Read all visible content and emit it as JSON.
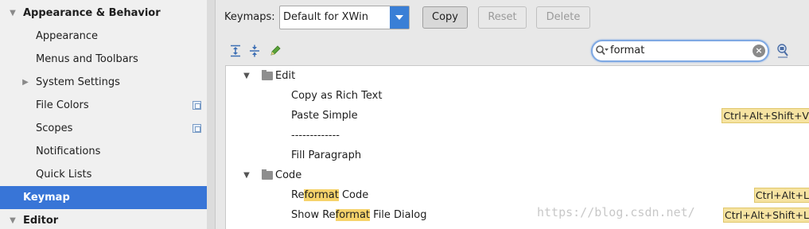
{
  "sidebar": {
    "items": [
      {
        "label": "Appearance & Behavior",
        "expanded": true
      },
      {
        "label": "Appearance"
      },
      {
        "label": "Menus and Toolbars"
      },
      {
        "label": "System Settings",
        "collapsed": true
      },
      {
        "label": "File Colors",
        "has_icon": true
      },
      {
        "label": "Scopes",
        "has_icon": true
      },
      {
        "label": "Notifications"
      },
      {
        "label": "Quick Lists"
      },
      {
        "label": "Keymap",
        "selected": true
      },
      {
        "label": "Editor",
        "expanded": true
      }
    ]
  },
  "keymaps": {
    "label": "Keymaps:",
    "selected": "Default for XWin",
    "copy_label": "Copy",
    "reset_label": "Reset",
    "delete_label": "Delete"
  },
  "search": {
    "value": "format"
  },
  "tree": {
    "edit": {
      "label": "Edit",
      "actions": [
        {
          "label": "Copy as Rich Text",
          "shortcut": ""
        },
        {
          "label": "Paste Simple",
          "shortcut": "Ctrl+Alt+Shift+V"
        },
        {
          "label": "-------------",
          "shortcut": ""
        },
        {
          "label": "Fill Paragraph",
          "shortcut": ""
        }
      ]
    },
    "code": {
      "label": "Code",
      "actions": [
        {
          "pre": "Re",
          "match": "format",
          "post": " Code",
          "shortcut": "Ctrl+Alt+L"
        },
        {
          "pre": "Show Re",
          "match": "format",
          "post": " File Dialog",
          "shortcut": "Ctrl+Alt+Shift+L"
        }
      ]
    }
  },
  "watermark": "https://blog.csdn.net/",
  "colors": {
    "selection": "#3875d7",
    "highlight": "#f6d36b",
    "shortcut_bg": "#f6e3a1"
  }
}
